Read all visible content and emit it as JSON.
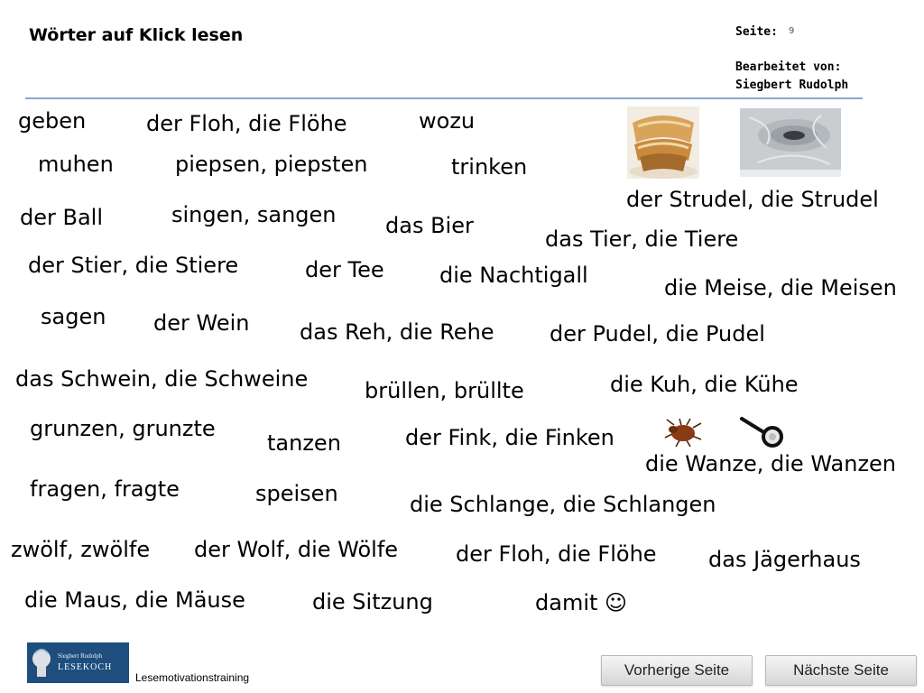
{
  "header": {
    "title": "Wörter auf Klick lesen",
    "page_label": "Seite:",
    "page_number": "9",
    "edited_label": "Bearbeitet von:",
    "editor": "Siegbert Rudolph"
  },
  "words": [
    "geben",
    "der Floh, die Flöhe",
    "wozu",
    "muhen",
    "piepsen, piepsten",
    "trinken",
    "der Strudel, die Strudel",
    "der Ball",
    "singen, sangen",
    "das Bier",
    "das Tier, die Tiere",
    "der Stier, die Stiere",
    "der Tee",
    "die Nachtigall",
    "die Meise, die Meisen",
    "sagen",
    "der Wein",
    "das Reh, die Rehe",
    "der Pudel, die Pudel",
    "das Schwein, die Schweine",
    "brüllen, brüllte",
    "die Kuh, die Kühe",
    "grunzen, grunzte",
    "tanzen",
    "der Fink, die Finken",
    "die Wanze, die Wanzen",
    "fragen, fragte",
    "speisen",
    "die Schlange, die Schlangen",
    "zwölf, zwölfe",
    "der Wolf, die Wölfe",
    "der Floh, die Flöhe",
    "das Jägerhaus",
    "die Maus, die Mäuse",
    "die Sitzung",
    "damit ☺"
  ],
  "images": [
    "strudel-photo",
    "whirlpool-photo",
    "bedbug-photo",
    "magnifier-image"
  ],
  "footer": {
    "logo_line1": "Siegbert Rudolph",
    "logo_line2": "LESEKOCH",
    "caption": "Lesemotivationstraining",
    "prev_label": "Vorherige Seite",
    "next_label": "Nächste Seite"
  },
  "colors": {
    "rule": "#8aa8c8",
    "logo_bg": "#1e4e7e"
  }
}
